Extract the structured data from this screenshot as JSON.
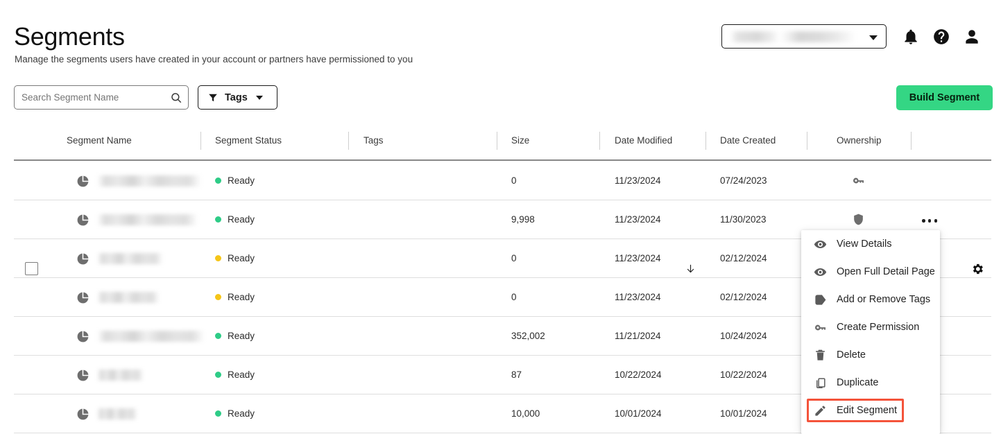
{
  "header": {
    "title": "Segments",
    "subtitle": "Manage the segments users have created in your account or partners have permissioned to you",
    "account_select": {
      "value": "",
      "redacted": true,
      "caret_icon": "chevron-down-icon"
    },
    "icons": [
      {
        "name": "notifications-bell-icon"
      },
      {
        "name": "help-circle-icon"
      },
      {
        "name": "user-account-icon"
      }
    ]
  },
  "toolbar": {
    "search": {
      "placeholder": "Search Segment Name",
      "value": "",
      "icon": "search-icon"
    },
    "tags_filter": {
      "label": "Tags",
      "icon": "funnel-filter-icon",
      "caret_icon": "chevron-down-icon"
    },
    "build_segment": {
      "label": "Build Segment",
      "color": "#34d684",
      "text_color": "#06220f"
    }
  },
  "table": {
    "select_all_checked": false,
    "settings_icon": "gear-icon",
    "columns": [
      {
        "key": "name",
        "label": "Segment Name"
      },
      {
        "key": "status",
        "label": "Segment Status"
      },
      {
        "key": "tags",
        "label": "Tags"
      },
      {
        "key": "size",
        "label": "Size"
      },
      {
        "key": "modified",
        "label": "Date Modified",
        "sort": "desc",
        "sort_icon": "arrow-down-icon"
      },
      {
        "key": "created",
        "label": "Date Created"
      },
      {
        "key": "owner",
        "label": "Ownership"
      }
    ],
    "status_colors": {
      "ready_green": "#2ecc87",
      "ready_yellow": "#f5c518"
    },
    "rows": [
      {
        "name": "",
        "name_redacted": true,
        "name_width": 150,
        "icon": "pie-chart-icon",
        "status": "Ready",
        "status_color": "#2ecc87",
        "tags": "",
        "size": "0",
        "modified": "11/23/2024",
        "created": "07/24/2023",
        "owner_icon": "key-icon",
        "menu_open": false
      },
      {
        "name": "",
        "name_redacted": true,
        "name_width": 145,
        "icon": "pie-chart-icon",
        "status": "Ready",
        "status_color": "#2ecc87",
        "tags": "",
        "size": "9,998",
        "modified": "11/23/2024",
        "created": "11/30/2023",
        "owner_icon": "shield-icon",
        "menu_open": true
      },
      {
        "name": "",
        "name_redacted": true,
        "name_width": 95,
        "icon": "pie-chart-icon",
        "status": "Ready",
        "status_color": "#f5c518",
        "tags": "",
        "size": "0",
        "modified": "11/23/2024",
        "created": "02/12/2024",
        "owner_icon": "",
        "menu_open": false
      },
      {
        "name": "",
        "name_redacted": true,
        "name_width": 90,
        "icon": "pie-chart-icon",
        "status": "Ready",
        "status_color": "#f5c518",
        "tags": "",
        "size": "0",
        "modified": "11/23/2024",
        "created": "02/12/2024",
        "owner_icon": "",
        "menu_open": false
      },
      {
        "name": "",
        "name_redacted": true,
        "name_width": 155,
        "icon": "pie-chart-icon",
        "status": "Ready",
        "status_color": "#2ecc87",
        "tags": "",
        "size": "352,002",
        "modified": "11/21/2024",
        "created": "10/24/2024",
        "owner_icon": "",
        "menu_open": false
      },
      {
        "name": "",
        "name_redacted": true,
        "name_width": 67,
        "icon": "pie-chart-icon",
        "status": "Ready",
        "status_color": "#2ecc87",
        "tags": "",
        "size": "87",
        "modified": "10/22/2024",
        "created": "10/22/2024",
        "owner_icon": "",
        "menu_open": false
      },
      {
        "name": "",
        "name_redacted": true,
        "name_width": 58,
        "icon": "pie-chart-icon",
        "status": "Ready",
        "status_color": "#2ecc87",
        "tags": "",
        "size": "10,000",
        "modified": "10/01/2024",
        "created": "10/01/2024",
        "owner_icon": "",
        "menu_open": false
      }
    ]
  },
  "context_menu": {
    "highlight_color": "#f4533a",
    "highlighted_item": "Edit Segment",
    "items": [
      {
        "label": "View Details",
        "icon": "eye-icon"
      },
      {
        "label": "Open Full Detail Page",
        "icon": "eye-icon"
      },
      {
        "label": "Add or Remove Tags",
        "icon": "tag-icon"
      },
      {
        "label": "Create Permission",
        "icon": "key-icon"
      },
      {
        "label": "Delete",
        "icon": "trash-icon"
      },
      {
        "label": "Duplicate",
        "icon": "copy-icon"
      },
      {
        "label": "Edit Segment",
        "icon": "pencil-icon",
        "highlighted": true
      }
    ]
  }
}
